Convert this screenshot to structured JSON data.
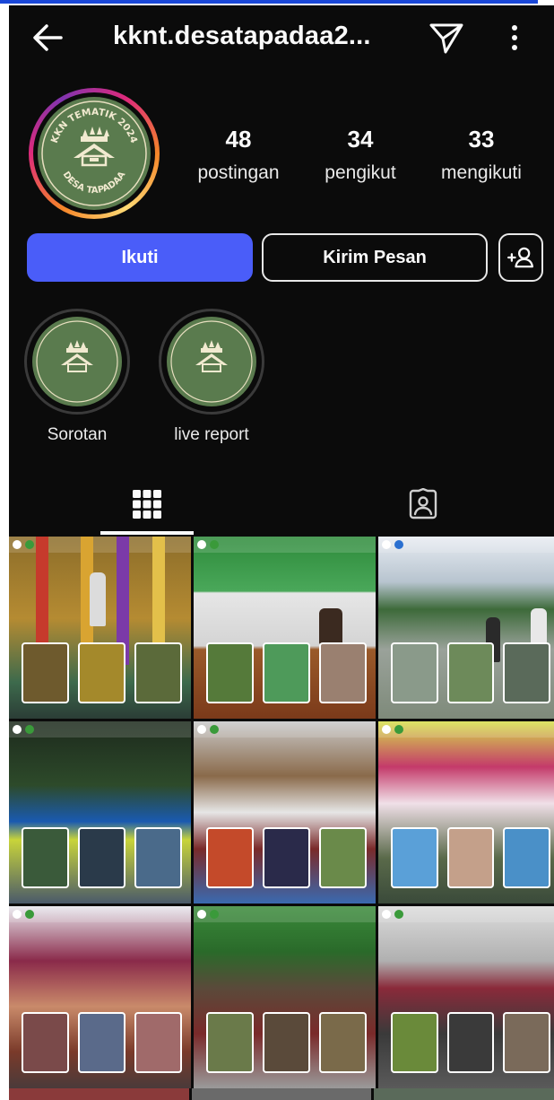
{
  "header": {
    "username": "kknt.desatapadaa2...",
    "back_icon": "back-arrow-icon",
    "send_icon": "send-icon",
    "more_icon": "more-vertical-icon"
  },
  "profile": {
    "logo_text_top": "KKN TEMATIK 2024",
    "logo_text_bottom": "DESA TAPADAA",
    "stats": [
      {
        "value": "48",
        "label": "postingan"
      },
      {
        "value": "34",
        "label": "pengikut"
      },
      {
        "value": "33",
        "label": "mengikuti"
      }
    ]
  },
  "actions": {
    "follow_label": "Ikuti",
    "message_label": "Kirim Pesan",
    "add_user_icon": "add-user-icon"
  },
  "highlights": [
    {
      "label": "Sorotan"
    },
    {
      "label": "live report"
    }
  ],
  "tabs": {
    "grid_icon": "grid-icon",
    "tagged_icon": "tagged-person-icon",
    "active": "grid"
  },
  "colors": {
    "accent": "#4a5df9",
    "background": "#0b0b0b",
    "logo_green": "#5a7b4e"
  }
}
